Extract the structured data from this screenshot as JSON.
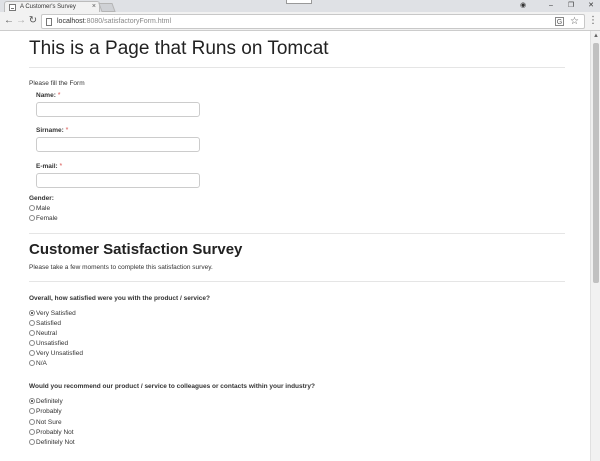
{
  "browser": {
    "tab_title": "A Customer's Survey",
    "tab_close": "×",
    "url_host": "localhost",
    "url_rest": ":8080/satisfactoryForm.html"
  },
  "page": {
    "title": "This is a Page that Runs on Tomcat",
    "intro": "Please fill the Form",
    "required_mark": "*",
    "fields": {
      "name_label": "Name:",
      "name_value": "",
      "surname_label": "Sirname:",
      "surname_value": "",
      "email_label": "E-mail:",
      "email_value": ""
    },
    "gender": {
      "label": "Gender:",
      "options": [
        "Male",
        "Female"
      ]
    },
    "survey": {
      "title": "Customer Satisfaction Survey",
      "subtitle": "Please take a few moments to complete this satisfaction survey.",
      "q1": {
        "text": "Overall, how satisfied were you with the product / service?",
        "options": [
          "Very Satisfied",
          "Satisfied",
          "Neutral",
          "Unsatisfied",
          "Very Unsatisfied",
          "N/A"
        ],
        "selected": "Very Satisfied"
      },
      "q2": {
        "text": "Would you recommend our product / service to colleagues or contacts within your industry?",
        "options": [
          "Definitely",
          "Probably",
          "Not Sure",
          "Probably Not",
          "Definitely Not"
        ],
        "selected": "Definitely"
      }
    }
  }
}
